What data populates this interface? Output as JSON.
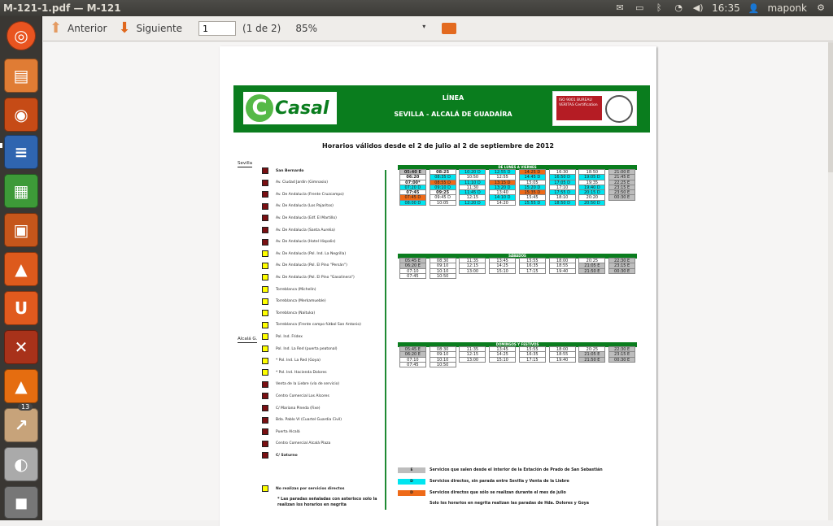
{
  "window": {
    "title": "M-121-1.pdf — M-121"
  },
  "panel": {
    "time": "16:35",
    "user": "maponk"
  },
  "launcher": {
    "badge": "13"
  },
  "toolbar": {
    "prev": "Anterior",
    "next": "Siguiente",
    "page_value": "1",
    "page_of": "(1 de 2)",
    "zoom": "85%"
  },
  "doc": {
    "line_label": "LÍNEA",
    "route": "SEVILLA - ALCALÁ DE GUADAÍRA",
    "logo_text": "Casal",
    "cert_text": "ISO 9001 BUREAU VERITAS Certification",
    "valid": "Horarios válidos desde el 2 de julio al 2 de septiembre de 2012",
    "zones": [
      "Sevilla",
      "Alcalá G."
    ],
    "stops": [
      {
        "name": "San Bernardo",
        "type": "red",
        "bold": true
      },
      {
        "name": "Av. Ciudad Jardín (Gimnasio)",
        "type": "red"
      },
      {
        "name": "Av. De Andalucía (Frente Cruzcampo)",
        "type": "red"
      },
      {
        "name": "Av. De Andalucía (Los Pajaritos)",
        "type": "red"
      },
      {
        "name": "Av. De Andalucía (Edf. El Martillo)",
        "type": "red"
      },
      {
        "name": "Av. De Andalucía (Santa Aurelia)",
        "type": "red"
      },
      {
        "name": "Av. De Andalucía (Hotel Hispalis)",
        "type": "red"
      },
      {
        "name": "Av. De Andalucía (Pol. Ind. La Negrilla)",
        "type": "yel"
      },
      {
        "name": "Av. De Andalucía (Pol. El Pino \"Persán\")",
        "type": "yel"
      },
      {
        "name": "Av. De Andalucía (Pol. El Pino \"Gasolinera\")",
        "type": "yel"
      },
      {
        "name": "Torreblanca (Michelín)",
        "type": "yel"
      },
      {
        "name": "Torreblanca (Merkamueble)",
        "type": "yel"
      },
      {
        "name": "Torreblanca (Naituka)",
        "type": "yel"
      },
      {
        "name": "Torreblanca (Frente campo fútbol San Antonio)",
        "type": "yel"
      },
      {
        "name": "Pol. Ind. Fridex",
        "type": "yel"
      },
      {
        "name": "Pol. Ind. La Red (puerta peatonal)",
        "type": "yel"
      },
      {
        "name": "* Pol. Ind. La Red (Goya)",
        "type": "yel"
      },
      {
        "name": "* Pol. Ind. Hacienda Dolores",
        "type": "yel"
      },
      {
        "name": "Venta de la Liebre (vía de servicio)",
        "type": "red"
      },
      {
        "name": "Centro Comercial Los Alcores",
        "type": "red"
      },
      {
        "name": "C/ Mariana Pineda (Fixe)",
        "type": "red"
      },
      {
        "name": "Bda. Pablo VI (Cuartel Guardia Civil)",
        "type": "red"
      },
      {
        "name": "Puerta Alcalá",
        "type": "red"
      },
      {
        "name": "Centro Comercial Alcalá Plaza",
        "type": "red"
      },
      {
        "name": "C/ Saturno",
        "type": "red",
        "bold": true
      }
    ],
    "tables": [
      {
        "title": "DE LUNES A VIERNES",
        "columns": [
          [
            [
              "05:40 E",
              "g",
              1
            ],
            [
              "06:20",
              "w",
              1
            ],
            [
              "07:00*",
              "w",
              1
            ],
            [
              "07:20 D",
              "c",
              0
            ],
            [
              "07:45",
              "w",
              1
            ],
            [
              "07:45 D",
              "o",
              0
            ],
            [
              "08:00 D",
              "c",
              0
            ]
          ],
          [
            [
              "08:25",
              "w",
              1
            ],
            [
              "08:35 D",
              "c",
              0
            ],
            [
              "08:55 D",
              "o",
              0
            ],
            [
              "09:10 D",
              "c",
              0
            ],
            [
              "09:25",
              "w",
              1
            ],
            [
              "09:45 D",
              "w",
              0
            ],
            [
              "10:05",
              "w",
              0
            ]
          ],
          [
            [
              "10:20 D",
              "c",
              0
            ],
            [
              "10:50",
              "w",
              0
            ],
            [
              "11:10 D",
              "c",
              0
            ],
            [
              "11:30",
              "w",
              0
            ],
            [
              "11:45 D",
              "c",
              0
            ],
            [
              "12:15",
              "w",
              0
            ],
            [
              "12:20 D",
              "c",
              0
            ]
          ],
          [
            [
              "12:55 D",
              "c",
              0
            ],
            [
              "12:55",
              "w",
              0
            ],
            [
              "13:15 D",
              "o",
              0
            ],
            [
              "13:20 D",
              "c",
              0
            ],
            [
              "13:40",
              "w",
              0
            ],
            [
              "14:10 D",
              "c",
              0
            ],
            [
              "14:20",
              "w",
              0
            ]
          ],
          [
            [
              "14:25 D",
              "o",
              0
            ],
            [
              "14:45 D",
              "c",
              0
            ],
            [
              "15:05",
              "w",
              0
            ],
            [
              "15:20 D",
              "c",
              0
            ],
            [
              "15:35 D",
              "o",
              0
            ],
            [
              "15:45",
              "w",
              0
            ],
            [
              "15:55 D",
              "c",
              0
            ]
          ],
          [
            [
              "16:30",
              "w",
              0
            ],
            [
              "16:50 D",
              "c",
              0
            ],
            [
              "17:05 D",
              "c",
              0
            ],
            [
              "17:10",
              "w",
              0
            ],
            [
              "17:55 D",
              "c",
              0
            ],
            [
              "18:10",
              "w",
              0
            ],
            [
              "18:50 D",
              "c",
              0
            ]
          ],
          [
            [
              "18:50",
              "w",
              0
            ],
            [
              "19:05 D",
              "c",
              0
            ],
            [
              "19:35",
              "w",
              0
            ],
            [
              "19:40 D",
              "c",
              0
            ],
            [
              "20:15 D",
              "c",
              0
            ],
            [
              "20:20",
              "w",
              0
            ],
            [
              "20:50 D",
              "c",
              0
            ]
          ],
          [
            [
              "21:00 E",
              "g",
              0
            ],
            [
              "21:45 E",
              "g",
              0
            ],
            [
              "22:25 E",
              "g",
              0
            ],
            [
              "23:15 E",
              "g",
              0
            ],
            [
              "23:50 E",
              "g",
              0
            ],
            [
              "00:30 E",
              "g",
              0
            ]
          ]
        ]
      },
      {
        "title": "SÁBADOS",
        "columns": [
          [
            [
              "05:45 E",
              "g",
              0
            ],
            [
              "06:20 E",
              "g",
              0
            ],
            [
              "07:10",
              "w",
              0
            ],
            [
              "07:45",
              "w",
              0
            ]
          ],
          [
            [
              "08:30",
              "w",
              0
            ],
            [
              "09:10",
              "w",
              0
            ],
            [
              "10:10",
              "w",
              0
            ],
            [
              "10:50",
              "w",
              0
            ]
          ],
          [
            [
              "11:35",
              "w",
              0
            ],
            [
              "12:15",
              "w",
              0
            ],
            [
              "13:00",
              "w",
              0
            ]
          ],
          [
            [
              "13:45",
              "w",
              0
            ],
            [
              "14:25",
              "w",
              0
            ],
            [
              "15:10",
              "w",
              0
            ]
          ],
          [
            [
              "15:55",
              "w",
              0
            ],
            [
              "16:35",
              "w",
              0
            ],
            [
              "17:15",
              "w",
              0
            ]
          ],
          [
            [
              "18:00",
              "w",
              0
            ],
            [
              "18:55",
              "w",
              0
            ],
            [
              "19:40",
              "w",
              0
            ]
          ],
          [
            [
              "20:25",
              "w",
              0
            ],
            [
              "21:05 E",
              "g",
              0
            ],
            [
              "21:50 E",
              "g",
              0
            ]
          ],
          [
            [
              "22:30 E",
              "g",
              0
            ],
            [
              "23:15 E",
              "g",
              0
            ],
            [
              "00:30 E",
              "g",
              0
            ]
          ]
        ]
      },
      {
        "title": "DOMINGOS Y FESTIVOS",
        "columns": [
          [
            [
              "05:45 E",
              "g",
              0
            ],
            [
              "06:20 E",
              "g",
              0
            ],
            [
              "07:10",
              "w",
              0
            ],
            [
              "07:45",
              "w",
              0
            ]
          ],
          [
            [
              "08:30",
              "w",
              0
            ],
            [
              "09:10",
              "w",
              0
            ],
            [
              "10:10",
              "w",
              0
            ],
            [
              "10:50",
              "w",
              0
            ]
          ],
          [
            [
              "11:35",
              "w",
              0
            ],
            [
              "12:15",
              "w",
              0
            ],
            [
              "13:00",
              "w",
              0
            ]
          ],
          [
            [
              "13:45",
              "w",
              0
            ],
            [
              "14:25",
              "w",
              0
            ],
            [
              "15:10",
              "w",
              0
            ]
          ],
          [
            [
              "15:55",
              "w",
              0
            ],
            [
              "16:35",
              "w",
              0
            ],
            [
              "17:15",
              "w",
              0
            ]
          ],
          [
            [
              "18:00",
              "w",
              0
            ],
            [
              "18:55",
              "w",
              0
            ],
            [
              "19:40",
              "w",
              0
            ]
          ],
          [
            [
              "20:25",
              "w",
              0
            ],
            [
              "21:05 E",
              "g",
              0
            ],
            [
              "21:50 E",
              "g",
              0
            ]
          ],
          [
            [
              "22:30 E",
              "g",
              0
            ],
            [
              "23:15 E",
              "g",
              0
            ],
            [
              "00:30 E",
              "g",
              0
            ]
          ]
        ]
      }
    ],
    "legend": [
      {
        "code": "E",
        "color": "#bdbdbd",
        "text": "Servicios que salen desde el interior de la Estación de Prado de San Sebastián"
      },
      {
        "code": "D",
        "color": "#00e5f0",
        "text": "Servicios directos, sin parada entre Sevilla y Venta de la Liebre"
      },
      {
        "code": "D",
        "color": "#ee6a18",
        "text": "Servicios directos que sólo se realizan durante el mes de julio"
      }
    ],
    "legend_note": "Solo los horarios en negrita realizan las paradas de Hda. Dolores y Goya",
    "note_yellow": "No realizas por servicios directos",
    "note_asterisk": "* Las paradas señaladas con asterisco solo la realizan los horarios en negrita"
  }
}
